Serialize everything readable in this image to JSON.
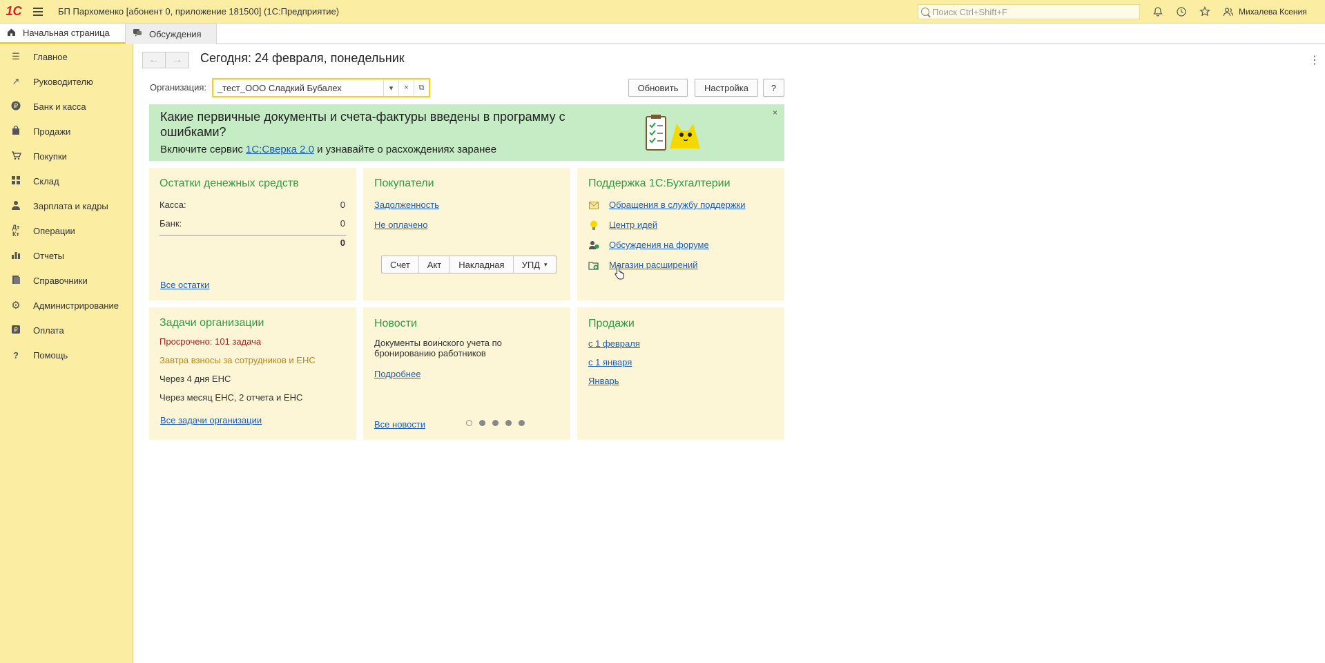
{
  "titlebar": {
    "logo": "1С",
    "title": "БП Пархоменко [абонент 0, приложение 181500]  (1С:Предприятие)",
    "search_placeholder": "Поиск Ctrl+Shift+F",
    "user": "Михалева Ксения",
    "icons": [
      "bell-icon",
      "history-icon",
      "star-icon",
      "users-icon"
    ]
  },
  "tabs": [
    {
      "label": "Начальная страница",
      "icon": "home-icon",
      "active": true
    },
    {
      "label": "Обсуждения",
      "icon": "chat-icon",
      "active": false
    }
  ],
  "sidebar": {
    "items": [
      {
        "label": "Главное",
        "icon": "menu-lines-icon"
      },
      {
        "label": "Руководителю",
        "icon": "trend-icon"
      },
      {
        "label": "Банк и касса",
        "icon": "ruble-icon"
      },
      {
        "label": "Продажи",
        "icon": "bag-icon"
      },
      {
        "label": "Покупки",
        "icon": "cart-icon"
      },
      {
        "label": "Склад",
        "icon": "grid-icon"
      },
      {
        "label": "Зарплата и кадры",
        "icon": "person-icon"
      },
      {
        "label": "Операции",
        "icon": "dt-kt-icon"
      },
      {
        "label": "Отчеты",
        "icon": "bars-icon"
      },
      {
        "label": "Справочники",
        "icon": "book-icon"
      },
      {
        "label": "Администрирование",
        "icon": "gear-icon"
      },
      {
        "label": "Оплата",
        "icon": "payment-icon"
      },
      {
        "label": "Помощь",
        "icon": "question-icon"
      }
    ]
  },
  "main": {
    "title": "Сегодня: 24 февраля, понедельник",
    "org_label": "Организация:",
    "org_value": "_тест_ООО Сладкий Бубалех",
    "refresh_label": "Обновить",
    "settings_label": "Настройка",
    "help_label": "?"
  },
  "banner": {
    "headline": "Какие первичные документы и счета-фактуры введены в программу с ошибками?",
    "sub_prefix": "Включите сервис ",
    "sub_link": "1С:Сверка 2.0",
    "sub_suffix": " и узнавайте о расхождениях заранее",
    "close": "×"
  },
  "widgets": {
    "cash": {
      "title": "Остатки денежных средств",
      "rows": [
        {
          "label": "Касса:",
          "value": "0"
        },
        {
          "label": "Банк:",
          "value": "0"
        }
      ],
      "total": "0",
      "link": "Все остатки"
    },
    "buyers": {
      "title": "Покупатели",
      "links": [
        "Задолженность",
        "Не оплачено"
      ],
      "buttons": [
        "Счет",
        "Акт",
        "Накладная",
        "УПД"
      ]
    },
    "support": {
      "title": "Поддержка 1С:Бухгалтерии",
      "links": [
        {
          "label": "Обращения в службу поддержки",
          "icon": "envelope-icon"
        },
        {
          "label": "Центр идей",
          "icon": "lightbulb-icon"
        },
        {
          "label": "Обсуждения на форуме",
          "icon": "forum-icon"
        },
        {
          "label": "Магазин расширений",
          "icon": "store-icon"
        }
      ]
    },
    "tasks": {
      "title": "Задачи организации",
      "items": [
        {
          "label": "Просрочено: 101 задача",
          "color": "#a12020"
        },
        {
          "label": "Завтра взносы за сотрудников и ЕНС",
          "color": "#b8860b"
        },
        {
          "label": "Через 4 дня ЕНС",
          "color": "#333333"
        },
        {
          "label": "Через месяц ЕНС, 2 отчета и ЕНС",
          "color": "#333333"
        }
      ],
      "link": "Все задачи организации"
    },
    "news": {
      "title": "Новости",
      "text": "Документы воинского учета по бронированию работников",
      "more": "Подробнее",
      "link": "Все новости",
      "pages": 5,
      "current_page": 1
    },
    "sales": {
      "title": "Продажи",
      "links": [
        "с 1 февраля",
        "с 1 января",
        "Январь"
      ]
    }
  },
  "colors": {
    "accent_yellow": "#fbeda2",
    "widget_bg": "#fdf6d6",
    "banner_bg": "#c5ecc4",
    "title_green": "#2b9c46",
    "link_blue": "#1c5db5"
  }
}
